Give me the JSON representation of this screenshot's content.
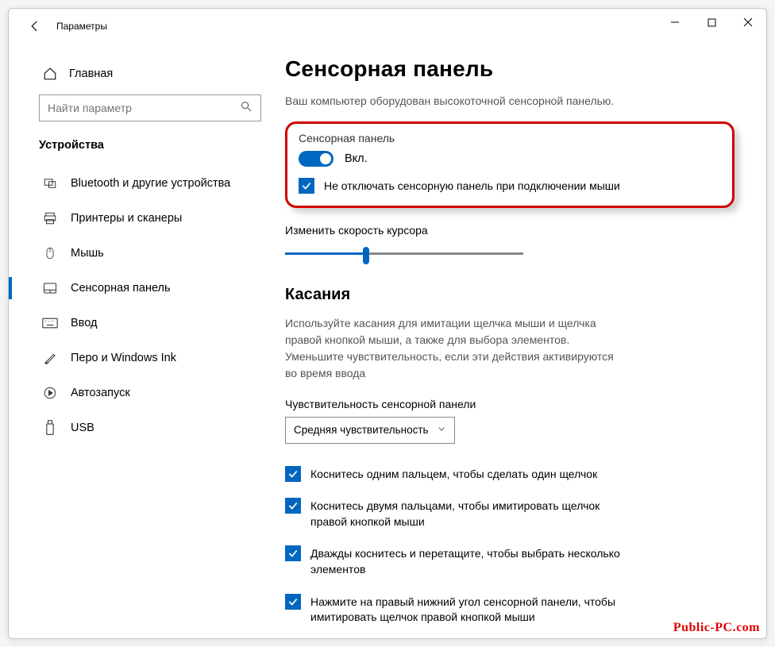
{
  "window": {
    "title": "Параметры"
  },
  "sidebar": {
    "home": "Главная",
    "search_placeholder": "Найти параметр",
    "category": "Устройства",
    "items": [
      {
        "id": "bluetooth",
        "label": "Bluetooth и другие устройства"
      },
      {
        "id": "printers",
        "label": "Принтеры и сканеры"
      },
      {
        "id": "mouse",
        "label": "Мышь"
      },
      {
        "id": "touchpad",
        "label": "Сенсорная панель",
        "selected": true
      },
      {
        "id": "typing",
        "label": "Ввод"
      },
      {
        "id": "pen",
        "label": "Перо и Windows Ink"
      },
      {
        "id": "autoplay",
        "label": "Автозапуск"
      },
      {
        "id": "usb",
        "label": "USB"
      }
    ]
  },
  "main": {
    "title": "Сенсорная панель",
    "subtitle": "Ваш компьютер оборудован высокоточной сенсорной панелью.",
    "touchpad_section_label": "Сенсорная панель",
    "toggle_state": "Вкл.",
    "keep_on_mouse": "Не отключать сенсорную панель при подключении мыши",
    "cursor_speed_label": "Изменить скорость курсора",
    "taps_heading": "Касания",
    "taps_desc": "Используйте касания для имитации щелчка мыши и щелчка правой кнопкой мыши, а также для выбора элементов. Уменьшите чувствительность, если эти действия активируются во время ввода",
    "sensitivity_label": "Чувствительность сенсорной панели",
    "sensitivity_value": "Средняя чувствительность",
    "tap_options": [
      "Коснитесь одним пальцем, чтобы сделать один щелчок",
      "Коснитесь двумя пальцами, чтобы имитировать щелчок правой кнопкой мыши",
      "Дважды коснитесь и перетащите, чтобы выбрать несколько элементов",
      "Нажмите на правый нижний угол сенсорной панели, чтобы имитировать щелчок правой кнопкой мыши"
    ]
  },
  "watermark": "Public-PC.com"
}
